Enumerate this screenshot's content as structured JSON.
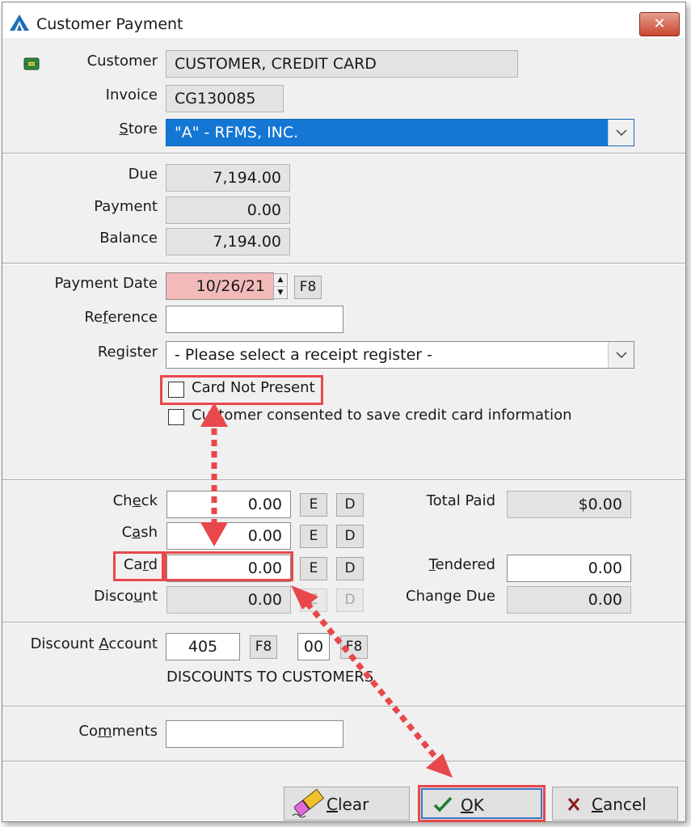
{
  "window": {
    "title": "Customer Payment",
    "close_glyph": "✕"
  },
  "customer": {
    "label": "Customer",
    "value": "CUSTOMER, CREDIT CARD",
    "icon": "credit-card-chip-icon"
  },
  "invoice": {
    "label": "Invoice",
    "value": "CG130085"
  },
  "store": {
    "label_pre": "",
    "label_key": "S",
    "label_post": "tore",
    "value": "\"A\" - RFMS, INC."
  },
  "due": {
    "label": "Due",
    "value": "7,194.00"
  },
  "payment": {
    "label": "Payment",
    "value": "0.00"
  },
  "balance": {
    "label": "Balance",
    "value": "7,194.00"
  },
  "payment_date": {
    "label": "Payment Date",
    "value": "10/26/21",
    "f8": "F8"
  },
  "reference": {
    "label_pre": "Re",
    "label_key": "f",
    "label_post": "erence",
    "value": ""
  },
  "register": {
    "label_pre": "Re",
    "label_key": "g",
    "label_post": "ister",
    "value": "- Please select a receipt register -"
  },
  "card_not_present": {
    "label": "Card Not Present",
    "checked": false
  },
  "consent": {
    "label": "Customer consented to save credit card information",
    "checked": false
  },
  "tenders": {
    "e_label": "E",
    "d_label": "D",
    "check": {
      "label_pre": "Ch",
      "label_key": "e",
      "label_post": "ck",
      "value": "0.00"
    },
    "cash": {
      "label_pre": "C",
      "label_key": "a",
      "label_post": "sh",
      "value": "0.00"
    },
    "card": {
      "label_pre": "Ca",
      "label_key": "r",
      "label_post": "d",
      "value": "0.00"
    },
    "discount": {
      "label_pre": "Disco",
      "label_key": "u",
      "label_post": "nt",
      "value": "0.00"
    }
  },
  "totals": {
    "total_paid": {
      "label": "Total Paid",
      "value": "$0.00"
    },
    "tendered": {
      "label_pre": "",
      "label_key": "T",
      "label_post": "endered",
      "value": "0.00"
    },
    "change_due": {
      "label": "Change Due",
      "value": "0.00"
    }
  },
  "discount_account": {
    "label_pre": "Discount ",
    "label_key": "A",
    "label_post": "ccount",
    "account": "405",
    "sub": "00",
    "f8": "F8",
    "description": "DISCOUNTS TO CUSTOMERS"
  },
  "comments": {
    "label_pre": "Co",
    "label_key": "m",
    "label_post": "ments",
    "value": ""
  },
  "buttons": {
    "clear": {
      "key": "C",
      "rest": "lear",
      "icon": "eraser-icon"
    },
    "ok": {
      "key": "O",
      "rest": "K",
      "icon": "checkmark-icon"
    },
    "cancel": {
      "key": "C",
      "rest": "ancel",
      "icon": "x-mark-icon"
    }
  },
  "colors": {
    "highlight": "#e8484b",
    "selection": "#1477d4",
    "date_field": "#f3baba"
  }
}
